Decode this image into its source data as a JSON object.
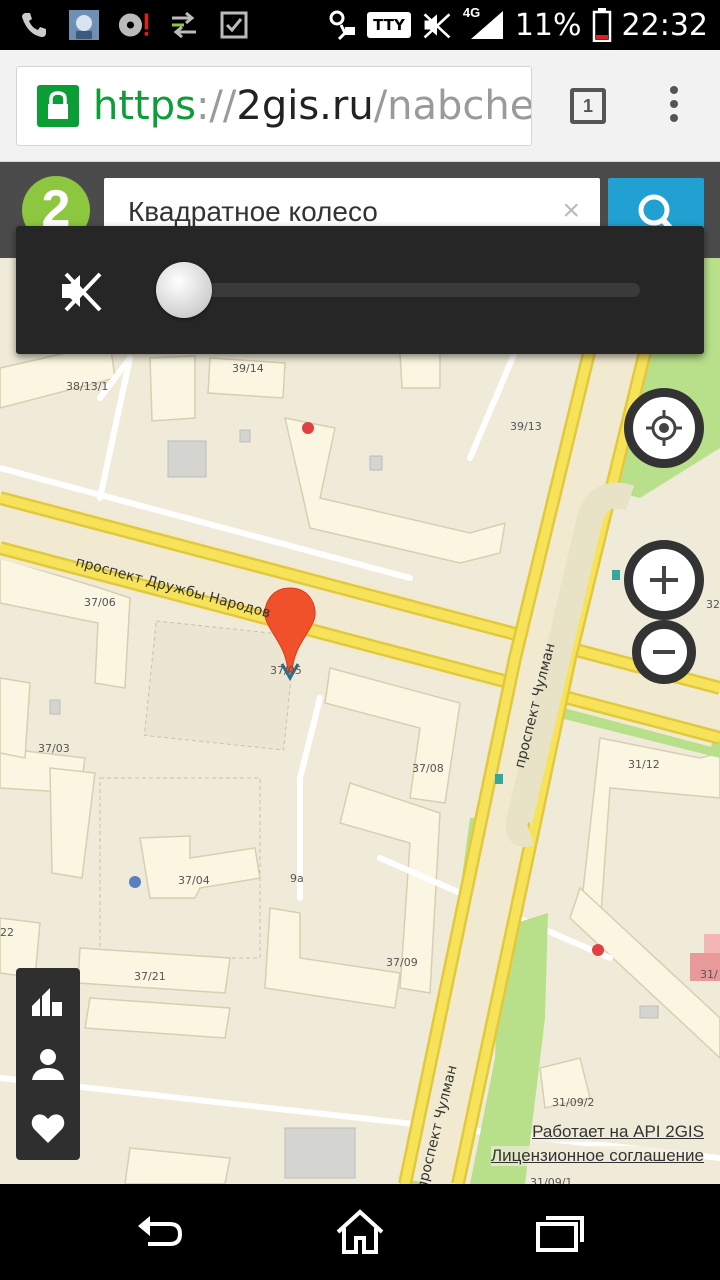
{
  "status_bar": {
    "network": "4G",
    "battery_percent": "11%",
    "time": "22:32",
    "tty_label": "TTY",
    "icons": [
      "phone-call-icon",
      "app-avatar-icon",
      "cd-alert-icon",
      "sync-arrows-icon",
      "checkbox-icon",
      "bluetooth-icon",
      "tty-icon",
      "mute-icon",
      "signal-icon",
      "battery-icon"
    ]
  },
  "browser": {
    "url_scheme": "https",
    "url_sep": "://",
    "url_host": "2gis.ru",
    "url_path": "/nabcheln",
    "tab_count": "1"
  },
  "site": {
    "logo": "2",
    "search_value": "Квадратное колесо",
    "clear_symbol": "×"
  },
  "volume": {
    "level": 0,
    "icon": "mute-icon"
  },
  "map": {
    "streets": {
      "main_avenue": "проспект Дружбы Народов",
      "cross_avenue_top": "проспект Чулман",
      "cross_avenue_bottom": "проспект Чулман"
    },
    "buildings": {
      "b1": "38/13/1",
      "b2": "39/14",
      "b3": "39/13",
      "b4": "37/06",
      "b5": "37/05",
      "b6": "37/03",
      "b7": "37/08",
      "b8": "31/12",
      "b9": "37/04",
      "b10": "9а",
      "b11": "37/09",
      "b12": "37/21",
      "b13": "31/09/2",
      "b14": "31/09/1",
      "b15": "31/",
      "b16": "32",
      "b17": "22"
    },
    "marker_color": "#f0502a"
  },
  "attribution": {
    "api": "Работает на API 2GIS",
    "license": "Лицензионное соглашение"
  },
  "colors": {
    "road_yellow": "#f7e35a",
    "road_edge": "#e2c83c",
    "park_green": "#b8e08a",
    "building": "#fbf6e1",
    "ground": "#f0ebd8",
    "search_blue": "#21a0d2",
    "logo_green": "#8dc63f"
  }
}
